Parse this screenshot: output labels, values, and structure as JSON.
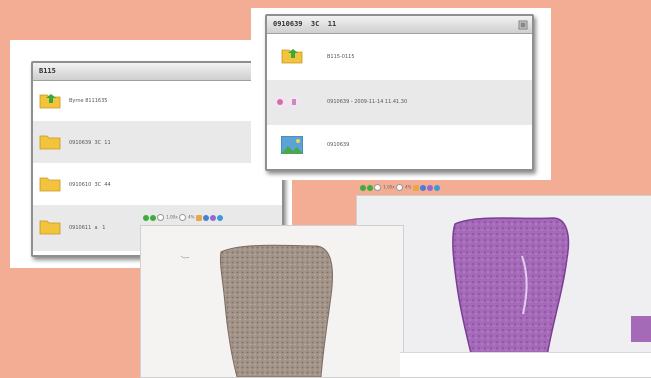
{
  "colors": {
    "background": "#f3ad94",
    "panel_border": "#8f8f8f",
    "row_alt": "#e9e9e9",
    "folder": "#f2c33c",
    "he_stain": "#a46ab8",
    "ihc_stain": "#9a8a80"
  },
  "panel_left": {
    "title": "B115",
    "items": [
      {
        "icon": "folder-up-icon",
        "label": "Byrne 8111635"
      },
      {
        "icon": "folder-icon",
        "label": "0910639  3C  11"
      },
      {
        "icon": "folder-icon",
        "label": "0910610  3C  44"
      },
      {
        "icon": "folder-icon",
        "label": "0910611  a   1"
      }
    ]
  },
  "panel_right": {
    "title": "0910639  3C  11",
    "items": [
      {
        "icon": "folder-up-icon",
        "label": "B115-0115"
      },
      {
        "icon": "slide-thumbnail-icon",
        "label": "0910639 - 2009-11-14 11.41.30"
      },
      {
        "icon": "image-icon",
        "label": "0910639"
      }
    ]
  },
  "viewer_ihc": {
    "toolbar": {
      "zoom": "1.00x",
      "rotation": "4%"
    }
  },
  "viewer_he": {
    "toolbar": {
      "zoom": "1.00x",
      "rotation": "4%"
    }
  }
}
